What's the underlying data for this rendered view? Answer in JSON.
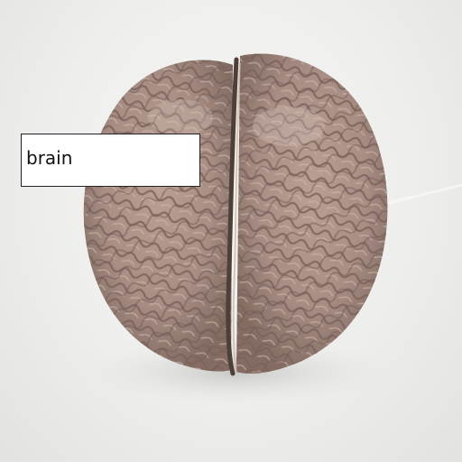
{
  "label": {
    "text": "brain"
  },
  "colors": {
    "background": "#ececea",
    "brain_base": "#a88e84",
    "brain_shadow": "#6f5a52",
    "brain_highlight": "#c9b3a8",
    "label_bg": "#ffffff",
    "label_border": "#222222"
  }
}
